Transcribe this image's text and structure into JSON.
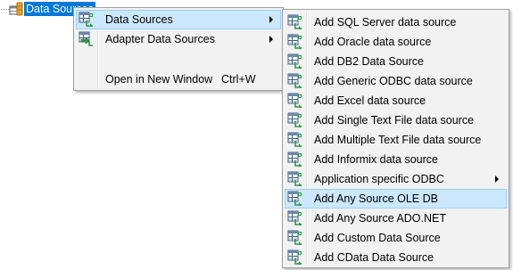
{
  "tree": {
    "node_label": "Data Sources",
    "node_icon": "database-icon"
  },
  "context_menu": {
    "items": [
      {
        "label": "Data Sources",
        "icon": "datasource-icon",
        "has_submenu": true,
        "highlighted": true
      },
      {
        "label": "Adapter Data Sources",
        "icon": "adapter-datasource-icon",
        "has_submenu": true
      },
      {
        "label": "Open in New Window",
        "shortcut": "Ctrl+W"
      }
    ]
  },
  "submenu": {
    "items": [
      {
        "label": "Add SQL Server data source",
        "icon": "datasource-icon"
      },
      {
        "label": "Add Oracle data source",
        "icon": "datasource-icon"
      },
      {
        "label": "Add DB2 Data Source",
        "icon": "datasource-icon"
      },
      {
        "label": "Add Generic ODBC data source",
        "icon": "datasource-icon"
      },
      {
        "label": "Add Excel data source",
        "icon": "datasource-icon"
      },
      {
        "label": "Add Single Text File data source",
        "icon": "datasource-icon"
      },
      {
        "label": "Add Multiple Text File data source",
        "icon": "datasource-icon"
      },
      {
        "label": "Add Informix data source",
        "icon": "datasource-icon"
      },
      {
        "label": "Application specific ODBC",
        "icon": "datasource-icon",
        "has_submenu": true
      },
      {
        "label": "Add Any Source OLE DB",
        "icon": "datasource-icon",
        "highlighted": true
      },
      {
        "label": "Add Any Source ADO.NET",
        "icon": "datasource-icon"
      },
      {
        "label": "Add Custom Data Source",
        "icon": "datasource-icon"
      },
      {
        "label": "Add CData Data Source",
        "icon": "datasource-icon"
      }
    ]
  },
  "colors": {
    "selection_blue": "#0078d7",
    "hover_fill": "#cce8ff",
    "hover_border": "#99d1ff",
    "menu_background": "#f2f2f2"
  }
}
